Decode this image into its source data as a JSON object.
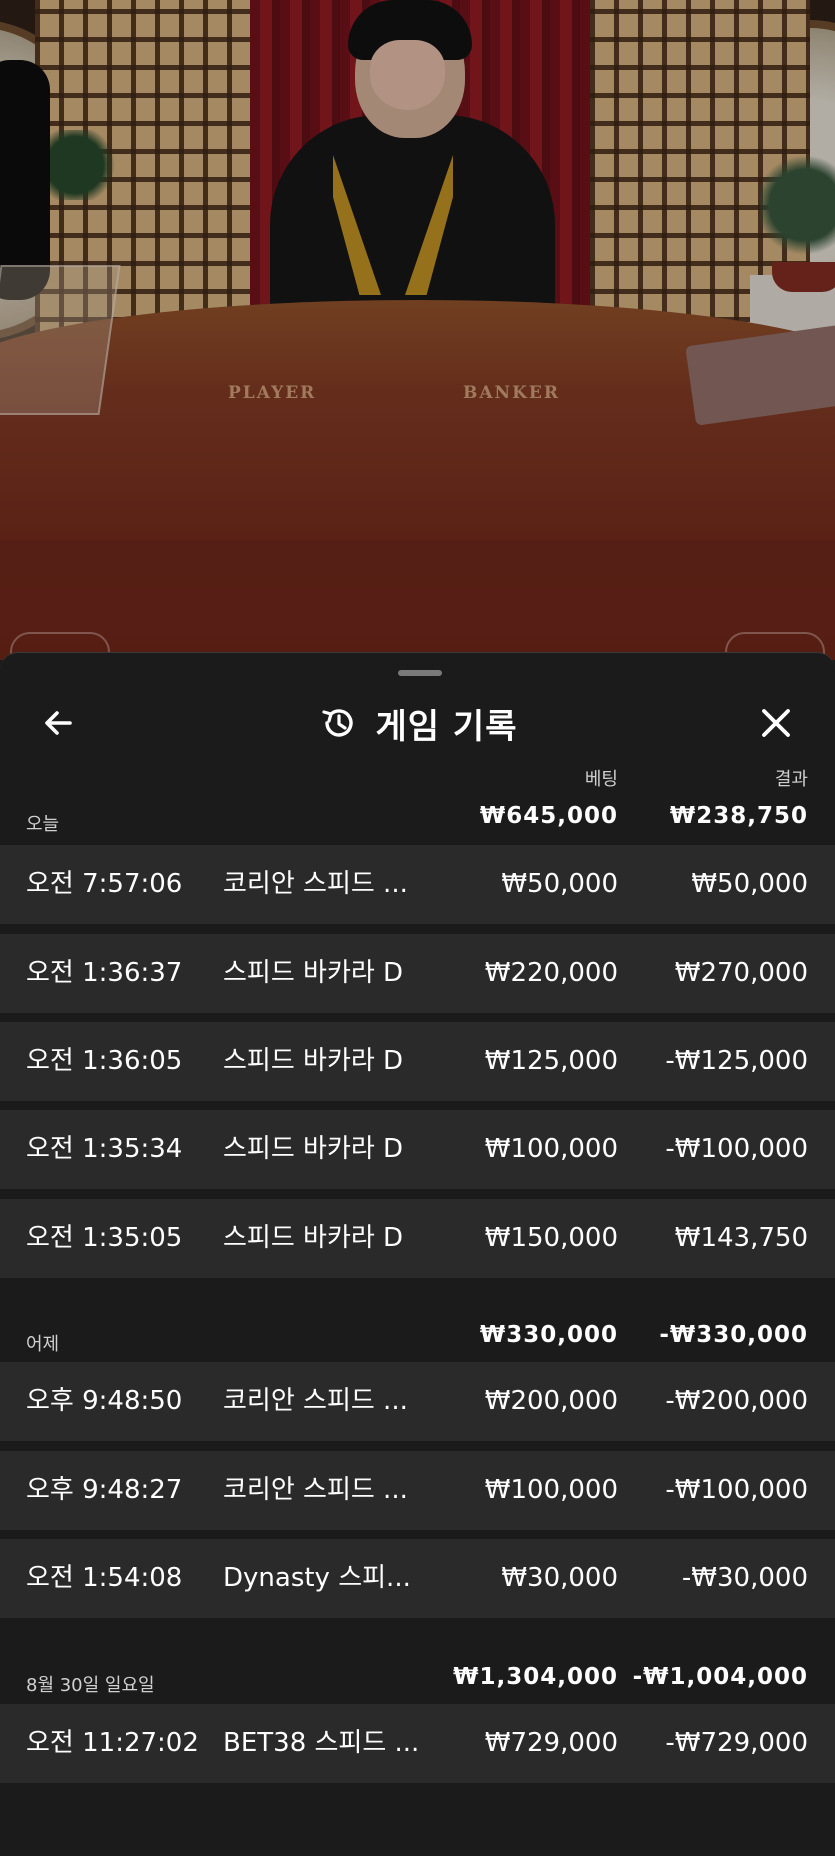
{
  "video": {
    "table_labels": [
      "PLAYER",
      "BANKER"
    ]
  },
  "sheet": {
    "title": "게임 기록",
    "icons": {
      "back": "arrow-left-icon",
      "title": "history-icon",
      "close": "close-icon"
    },
    "columns": {
      "bet": "베팅",
      "result": "결과"
    },
    "groups": [
      {
        "label": "오늘",
        "bet_total": "₩645,000",
        "result_total": "₩238,750",
        "rows": [
          {
            "time": "오전 7:57:06",
            "game": "코리안 스피드 ...",
            "bet": "₩50,000",
            "result": "₩50,000"
          },
          {
            "time": "오전 1:36:37",
            "game": "스피드 바카라 D",
            "bet": "₩220,000",
            "result": "₩270,000"
          },
          {
            "time": "오전 1:36:05",
            "game": "스피드 바카라 D",
            "bet": "₩125,000",
            "result": "-₩125,000"
          },
          {
            "time": "오전 1:35:34",
            "game": "스피드 바카라 D",
            "bet": "₩100,000",
            "result": "-₩100,000"
          },
          {
            "time": "오전 1:35:05",
            "game": "스피드 바카라 D",
            "bet": "₩150,000",
            "result": "₩143,750"
          }
        ]
      },
      {
        "label": "어제",
        "bet_total": "₩330,000",
        "result_total": "-₩330,000",
        "rows": [
          {
            "time": "오후 9:48:50",
            "game": "코리안 스피드 ...",
            "bet": "₩200,000",
            "result": "-₩200,000"
          },
          {
            "time": "오후 9:48:27",
            "game": "코리안 스피드 ...",
            "bet": "₩100,000",
            "result": "-₩100,000"
          },
          {
            "time": "오전 1:54:08",
            "game": "Dynasty 스피...",
            "bet": "₩30,000",
            "result": "-₩30,000"
          }
        ]
      },
      {
        "label": "8월 30일 일요일",
        "bet_total": "₩1,304,000",
        "result_total": "-₩1,004,000",
        "rows": [
          {
            "time": "오전 11:27:02",
            "game": "BET38 스피드 ...",
            "bet": "₩729,000",
            "result": "-₩729,000"
          }
        ]
      }
    ]
  },
  "colors": {
    "sheet_bg": "#1b1b1b",
    "row_bg": "#2a2a2a",
    "text": "#ffffff",
    "muted": "#cfcfcf"
  }
}
